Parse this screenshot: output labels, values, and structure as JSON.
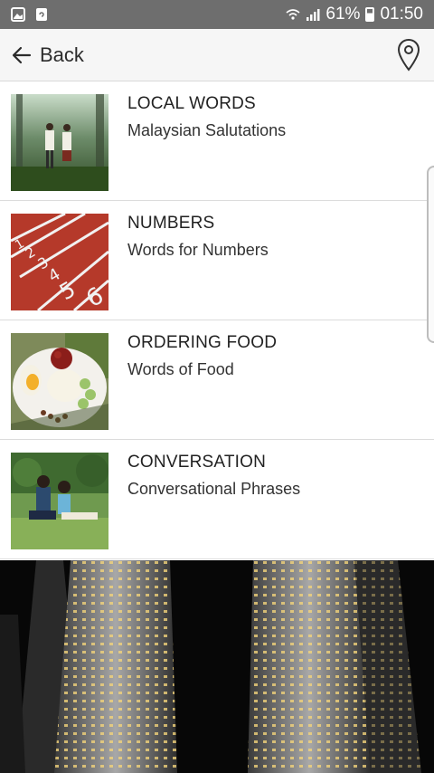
{
  "status_bar": {
    "battery": "61%",
    "time": "01:50",
    "left_icons": [
      "gallery-icon",
      "phone-sync-icon"
    ],
    "right_icons": [
      "wifi-icon",
      "signal-icon",
      "battery-icon"
    ]
  },
  "header": {
    "back_label": "Back",
    "back_icon": "arrow-left-icon",
    "location_icon": "map-pin-icon"
  },
  "items": [
    {
      "title": "LOCAL WORDS",
      "subtitle": "Malaysian Salutations",
      "image": "couple-in-forest"
    },
    {
      "title": "NUMBERS",
      "subtitle": "Words for Numbers",
      "image": "running-track-lanes"
    },
    {
      "title": "ORDERING FOOD",
      "subtitle": "Words of Food",
      "image": "nasi-lemak-plate"
    },
    {
      "title": "CONVERSATION",
      "subtitle": "Conversational Phrases",
      "image": "couple-in-park"
    }
  ],
  "banner_image": "petronas-towers-night",
  "colors": {
    "status_bar": "#6e6e6e",
    "app_bar": "#f6f6f6",
    "divider": "#dcdcdc",
    "text": "#222222"
  }
}
